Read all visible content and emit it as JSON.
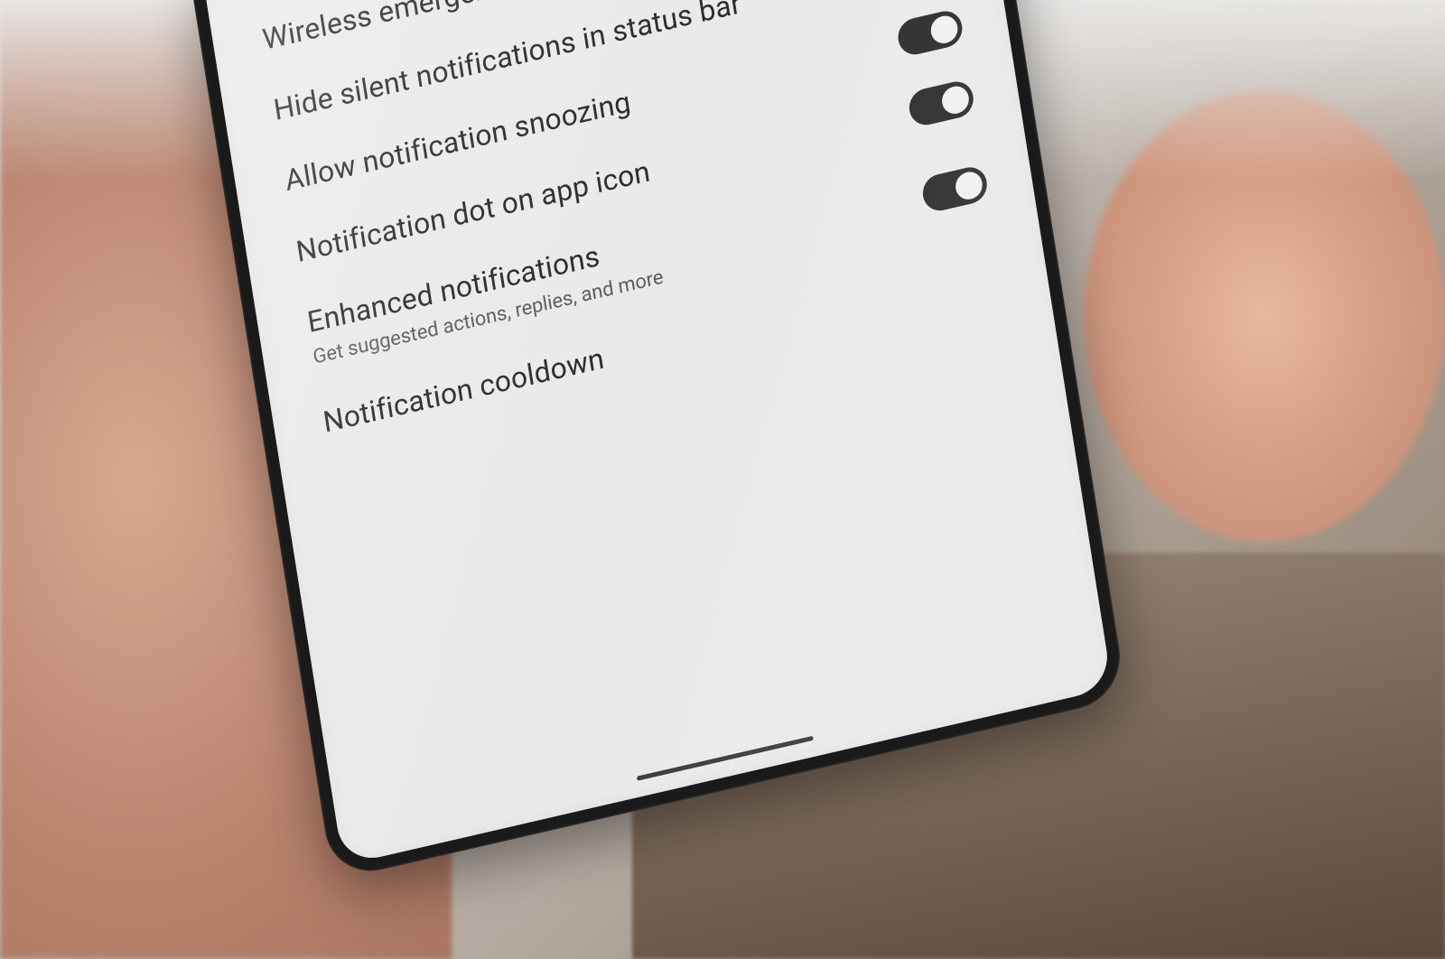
{
  "settings": {
    "items": [
      {
        "title": "Wireless emergency alerts",
        "subtitle": "",
        "toggle_state": "off",
        "has_toggle": true
      },
      {
        "title": "Hide silent notifications in status bar",
        "subtitle": "",
        "toggle_state": "off",
        "has_toggle": true
      },
      {
        "title": "Allow notification snoozing",
        "subtitle": "",
        "toggle_state": "on",
        "has_toggle": true
      },
      {
        "title": "Notification dot on app icon",
        "subtitle": "",
        "toggle_state": "on",
        "has_toggle": true
      },
      {
        "title": "Enhanced notifications",
        "subtitle": "Get suggested actions, replies, and more",
        "toggle_state": "on",
        "has_toggle": true
      },
      {
        "title": "Notification cooldown",
        "subtitle": "",
        "toggle_state": "",
        "has_toggle": false
      }
    ]
  }
}
